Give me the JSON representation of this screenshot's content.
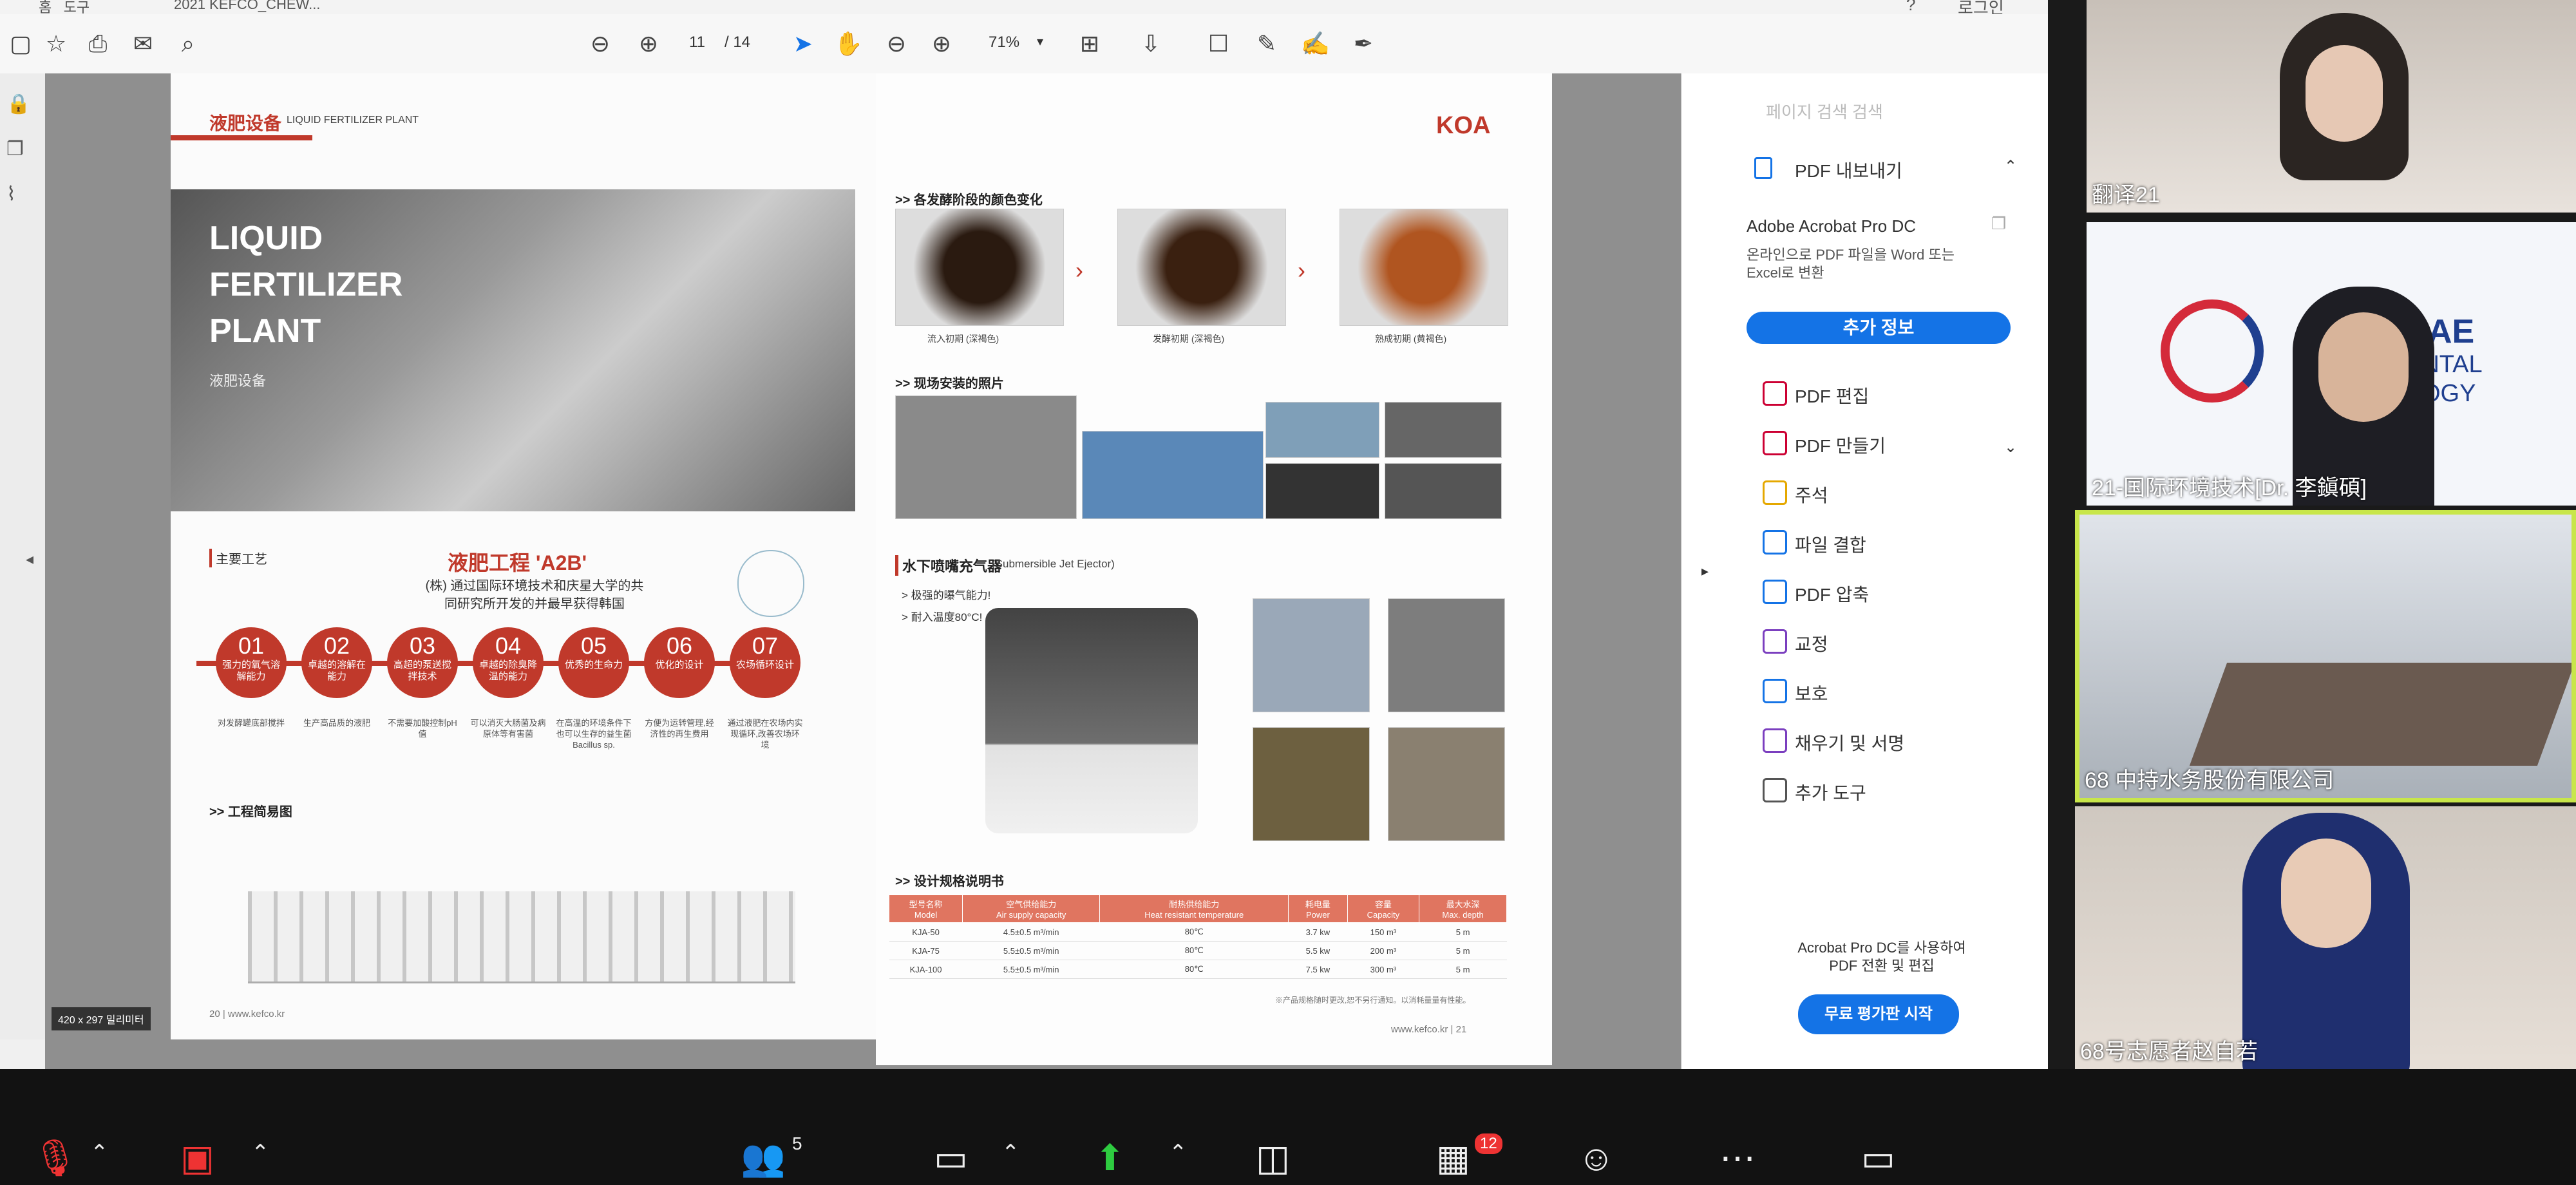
{
  "window": {
    "title": "2021 KEFCO_CHEW...",
    "login": "로그인"
  },
  "toolbar": {
    "page_current": "11",
    "page_total": "/ 14",
    "zoom": "71%"
  },
  "page_a": {
    "section_title": "液肥设备",
    "section_title_en": "LIQUID FERTILIZER PLANT",
    "hero_title": [
      "LIQUID",
      "FERTILIZER",
      "PLANT"
    ],
    "hero_sub": "液肥设备",
    "process_label": "主要工艺",
    "process_title": "液肥工程 'A2B'",
    "process_desc": [
      "(株) 通过国际环境技术和庆星大学的共",
      "同研究所开发的并最早获得韩国"
    ],
    "steps": [
      {
        "n": "01",
        "t": "强力的氧气溶解能力",
        "d": "对发酵罐底部搅拌"
      },
      {
        "n": "02",
        "t": "卓越的溶解在能力",
        "d": "生产高品质的液肥"
      },
      {
        "n": "03",
        "t": "高超的泵送搅拌技术",
        "d": "不需要加酸控制pH值"
      },
      {
        "n": "04",
        "t": "卓越的除臭降温的能力",
        "d": "可以消灭大肠菌及病原体等有害菌"
      },
      {
        "n": "05",
        "t": "优秀的生命力",
        "d": "在高温的环境条件下也可以生存的益生菌Bacillus sp."
      },
      {
        "n": "06",
        "t": "优化的设计",
        "d": "方便为运转管理,经济性的再生费用"
      },
      {
        "n": "07",
        "t": "农场循环设计",
        "d": "通过液肥在农场内实现循环,改善农场环境"
      }
    ],
    "diagram_label": ">> 工程简易图",
    "footer": "20 | www.kefco.kr",
    "size_badge": "420 x 297 밀리미터"
  },
  "page_b": {
    "logo": "KOA",
    "color_title": ">> 各发酵阶段的颜色变化",
    "color_captions": [
      "流入初期 (深褐色)",
      "发酵初期 (深褐色)",
      "熟成初期 (黄褐色)"
    ],
    "site_title": ">> 现场安装的照片",
    "ejector_title": "水下喷嘴充气器",
    "ejector_en": "(Submersible Jet Ejector)",
    "ejector_points": [
      "> 极强的曝气能力!",
      "> 耐入温度80°C!"
    ],
    "spec_title": ">> 设计规格说明书",
    "spec_headers": [
      "型号名称\nModel",
      "空气供给能力\nAir supply capacity",
      "耐热供给能力\nHeat resistant temperature",
      "耗电量\nPower",
      "容量\nCapacity",
      "最大水深\nMax. depth"
    ],
    "spec_rows": [
      [
        "KJA-50",
        "4.5±0.5 m³/min",
        "80℃",
        "3.7 kw",
        "150 m³",
        "5 m"
      ],
      [
        "KJA-75",
        "5.5±0.5 m³/min",
        "80℃",
        "5.5 kw",
        "200 m³",
        "5 m"
      ],
      [
        "KJA-100",
        "5.5±0.5 m³/min",
        "80℃",
        "7.5 kw",
        "300 m³",
        "5 m"
      ]
    ],
    "note": "※产品规格随时更改,恕不另行通知。以消耗量量有性能。",
    "footer": "www.kefco.kr | 21"
  },
  "panel": {
    "search": "페이지 검색 검색",
    "export": "PDF 내보내기",
    "product": "Adobe Acrobat Pro DC",
    "product_desc": [
      "온라인으로 PDF 파일을 Word 또는",
      "Excel로 변환"
    ],
    "more_info": "추가 정보",
    "tools": [
      "PDF 편집",
      "PDF 만들기",
      "주석",
      "파일 결합",
      "PDF 압축",
      "교정",
      "보호",
      "채우기 및 서명",
      "추가 도구"
    ],
    "promo": [
      "Acrobat Pro DC를 사용하여",
      "PDF 전환 및 편집"
    ],
    "trial": "무료 평가판 시작"
  },
  "video": {
    "tiles": [
      {
        "label": "翻译21"
      },
      {
        "label": "21-国际环境技术[Dr. 李鎭碩]",
        "logo_text": [
          "AE",
          "ENTAL",
          "OGY"
        ]
      },
      {
        "label": "68 中持水务股份有限公司"
      },
      {
        "label": "68号志愿者赵自若"
      }
    ]
  },
  "zoom": {
    "participants": "5",
    "chat_badge": "12"
  },
  "colors": {
    "accent_red": "#c0392b",
    "acrobat_blue": "#1473e6",
    "active_speaker": "#c8e64a"
  }
}
